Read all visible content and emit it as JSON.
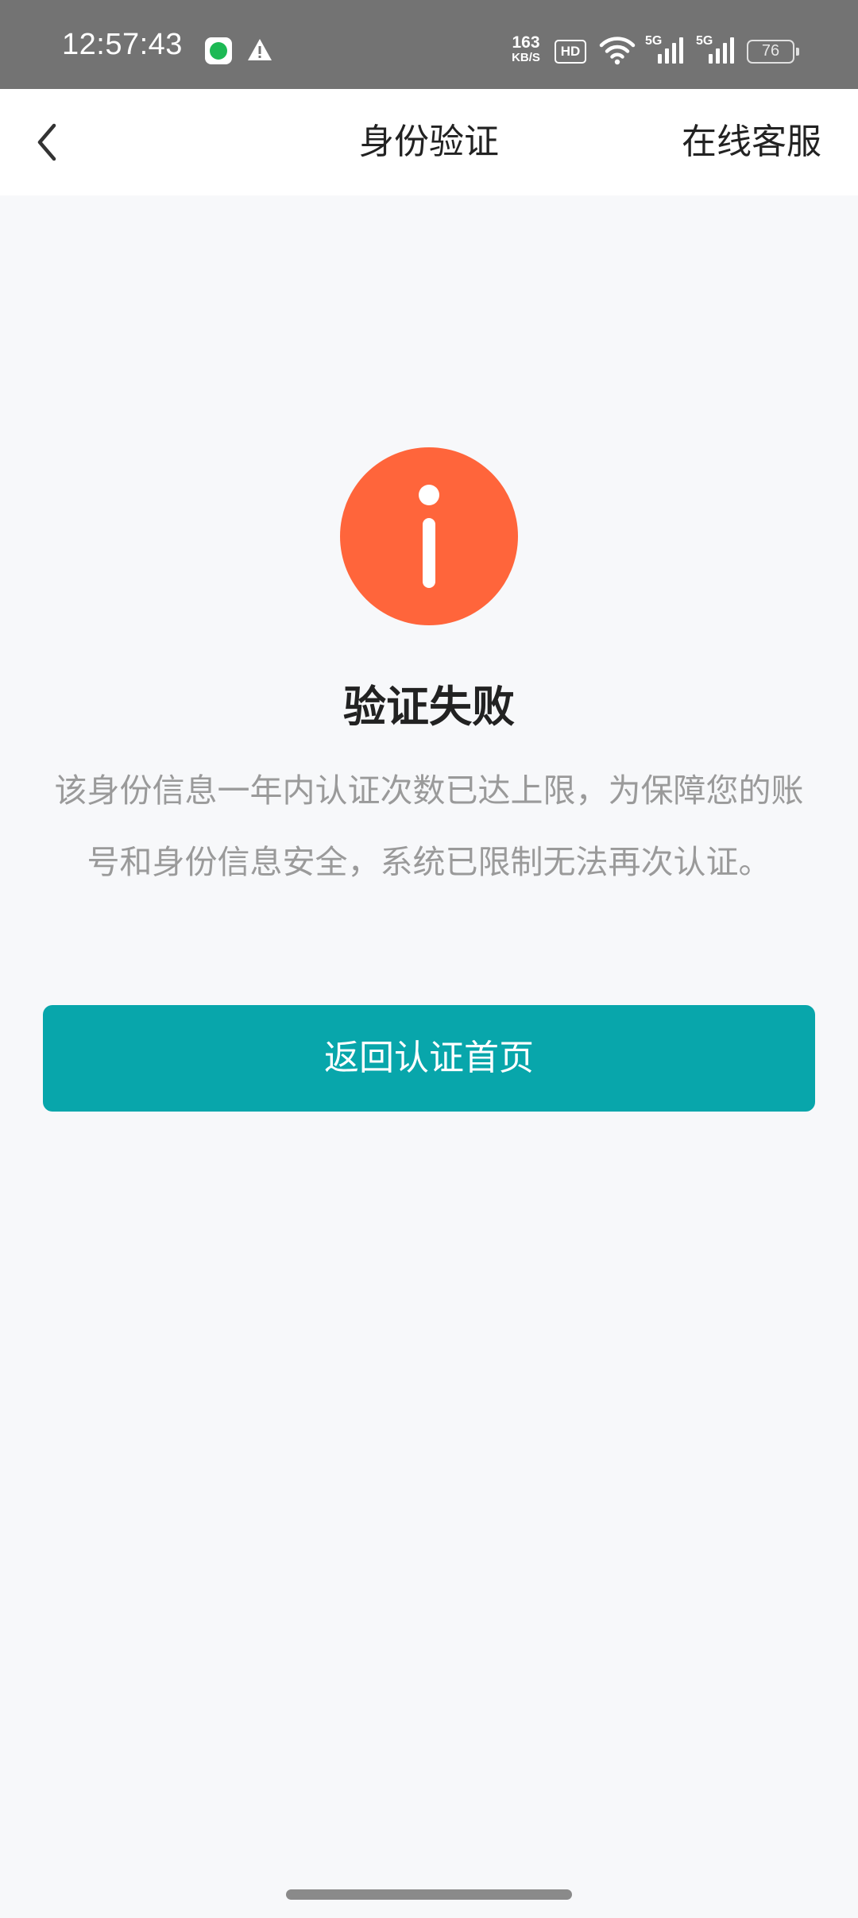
{
  "status_bar": {
    "time": "12:57:43",
    "net_speed_value": "163",
    "net_speed_unit": "KB/S",
    "hd_label": "HD",
    "signal_1_label": "5G",
    "signal_2_label": "5G",
    "battery_level": "76"
  },
  "nav": {
    "title": "身份验证",
    "service_label": "在线客服"
  },
  "result": {
    "icon": "info-icon",
    "icon_color": "#ff653b",
    "title": "验证失败",
    "description": "该身份信息一年内认证次数已达上限，为保障您的账号和身份信息安全，系统已限制无法再次认证。"
  },
  "actions": {
    "primary_label": "返回认证首页",
    "primary_color": "#08a6ab"
  }
}
